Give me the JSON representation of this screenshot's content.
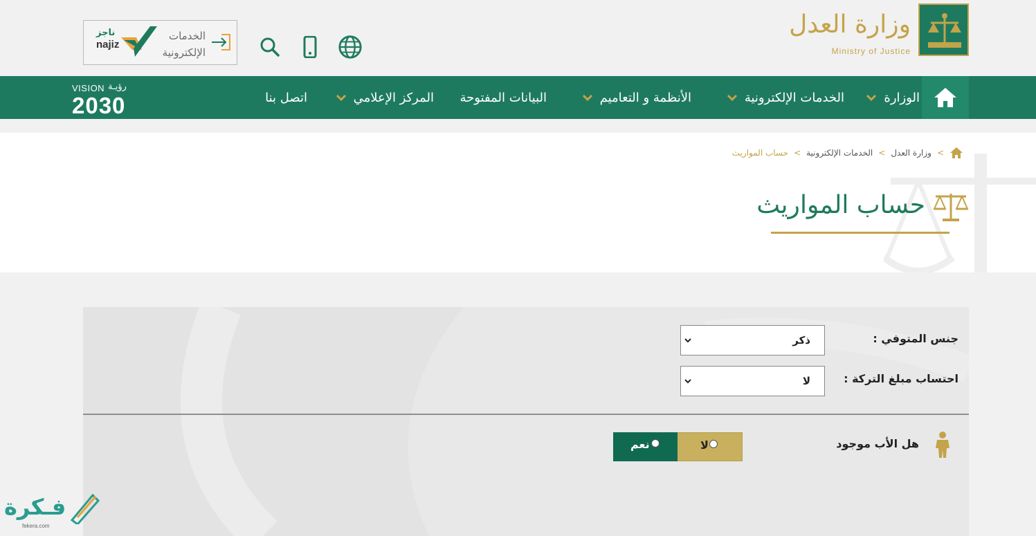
{
  "header": {
    "logo_ar": "وزارة العدل",
    "logo_en": "Ministry of Justice",
    "eservices_line1": "الخدمات",
    "eservices_line2": "الإلكترونية",
    "najiz_ar": "ناجز",
    "najiz_en": "najiz"
  },
  "nav": {
    "items": [
      {
        "label": "الوزارة",
        "has_dropdown": true
      },
      {
        "label": "الخدمات الإلكترونية",
        "has_dropdown": true
      },
      {
        "label": "الأنظمة و التعاميم",
        "has_dropdown": true
      },
      {
        "label": "البيانات المفتوحة",
        "has_dropdown": false
      },
      {
        "label": "المركز الإعلامي",
        "has_dropdown": true
      },
      {
        "label": "اتصل بنا",
        "has_dropdown": false
      }
    ],
    "vision_en": "VISION",
    "vision_ar": "رؤيـة",
    "vision_year": "2030"
  },
  "breadcrumb": {
    "items": [
      "وزارة العدل",
      "الخدمات الإلكترونية",
      "حساب المواريث"
    ],
    "separator": ">"
  },
  "page": {
    "title": "حساب المواريث"
  },
  "form": {
    "gender_label": "جنس المتوفي :",
    "gender_value": "ذكر",
    "estate_label": "احتساب مبلغ التركة :",
    "estate_value": "لا",
    "father_label": "هل الأب موجود",
    "option_no": "لا",
    "option_yes": "نعم"
  },
  "watermark": {
    "text": "فـكرة",
    "sub": "fekera.com"
  },
  "colors": {
    "primary_green": "#1e7a5e",
    "gold": "#c4a34a",
    "dark_green": "#106a50"
  }
}
